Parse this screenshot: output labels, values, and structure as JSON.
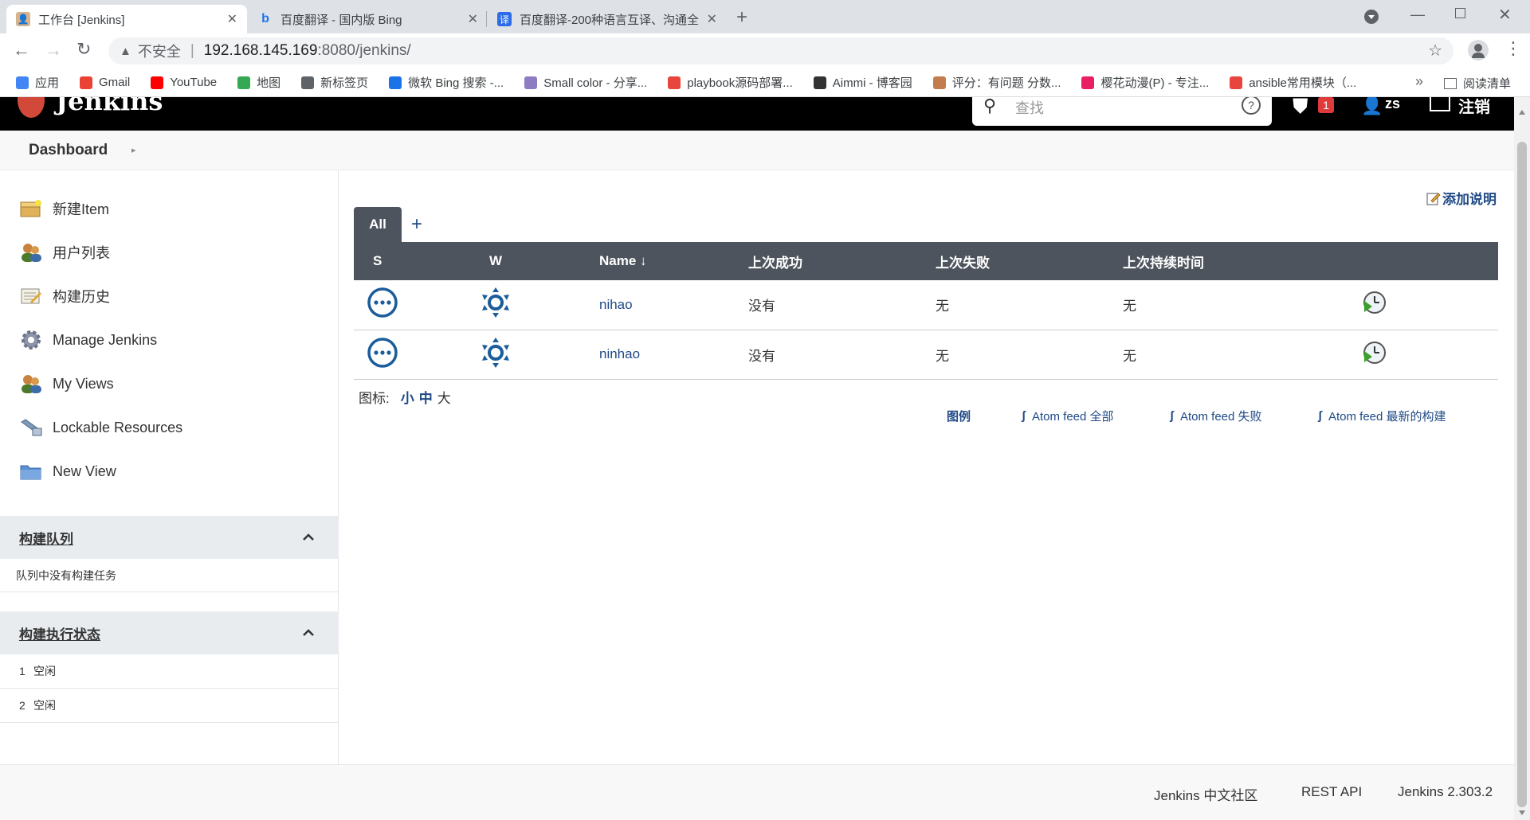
{
  "browser": {
    "tabs": [
      {
        "title": "工作台 [Jenkins]",
        "active": true
      },
      {
        "title": "百度翻译 - 国内版 Bing",
        "active": false
      },
      {
        "title": "百度翻译-200种语言互译、沟通全",
        "active": false
      }
    ],
    "new_tab": "+",
    "security_label": "不安全",
    "url_host": "192.168.145.169",
    "url_rest": ":8080/jenkins/",
    "bookmarks": [
      {
        "label": "应用",
        "color": "#4285f4"
      },
      {
        "label": "Gmail",
        "color": "#ea4335"
      },
      {
        "label": "YouTube",
        "color": "#ff0000"
      },
      {
        "label": "地图",
        "color": "#34a853"
      },
      {
        "label": "新标签页",
        "color": "#5f6368"
      },
      {
        "label": "微软 Bing 搜索 -...",
        "color": "#1a73e8"
      },
      {
        "label": "Small color - 分享...",
        "color": "#8e7cc3"
      },
      {
        "label": "playbook源码部署...",
        "color": "#e8453c"
      },
      {
        "label": "Aimmi - 博客园",
        "color": "#333333"
      },
      {
        "label": "评分：有问题 分数...",
        "color": "#c27c4e"
      },
      {
        "label": "樱花动漫(P) - 专注...",
        "color": "#e91e63"
      },
      {
        "label": "ansible常用模块（...",
        "color": "#e8453c"
      }
    ],
    "more_bookmarks": "»",
    "reading_list": "阅读清单"
  },
  "header": {
    "logo_text": "Jenkins",
    "search_placeholder": "查找",
    "alert_count": "1",
    "user": "zs",
    "logout": "注销"
  },
  "breadcrumb": {
    "dashboard": "Dashboard"
  },
  "sidebar": {
    "tasks": [
      {
        "label": "新建Item",
        "icon": "new-item-icon"
      },
      {
        "label": "用户列表",
        "icon": "users-icon"
      },
      {
        "label": "构建历史",
        "icon": "build-history-icon"
      },
      {
        "label": "Manage Jenkins",
        "icon": "gear-icon"
      },
      {
        "label": "My Views",
        "icon": "views-icon"
      },
      {
        "label": "Lockable Resources",
        "icon": "lock-resources-icon"
      },
      {
        "label": "New View",
        "icon": "folder-icon"
      }
    ],
    "queue": {
      "title": "构建队列",
      "empty_text": "队列中没有构建任务"
    },
    "executors": {
      "title": "构建执行状态",
      "rows": [
        {
          "num": "1",
          "status": "空闲"
        },
        {
          "num": "2",
          "status": "空闲"
        }
      ]
    }
  },
  "main": {
    "add_description": "添加说明",
    "view_tabs": {
      "active": "All",
      "add": "+"
    },
    "table": {
      "headers": [
        "S",
        "W",
        "Name ↓",
        "上次成功",
        "上次失败",
        "上次持续时间"
      ],
      "rows": [
        {
          "name": "nihao",
          "last_success": "没有",
          "last_failure": "无",
          "last_duration": "无"
        },
        {
          "name": "ninhao",
          "last_success": "没有",
          "last_failure": "无",
          "last_duration": "无"
        }
      ]
    },
    "icon_size": {
      "label": "图标:",
      "small": "小",
      "medium": "中",
      "large": "大"
    },
    "feeds": {
      "legend": "图例",
      "all": "Atom feed 全部",
      "failed": "Atom feed 失败",
      "latest": "Atom feed 最新的构建"
    }
  },
  "footer": {
    "community": "Jenkins 中文社区",
    "rest_api": "REST API",
    "version": "Jenkins 2.303.2"
  },
  "colors": {
    "header_bg": "#000000",
    "table_header": "#4d545d",
    "link": "#204a87",
    "status_blue": "#1b5c9b",
    "panel_bg": "#e9ecef"
  }
}
